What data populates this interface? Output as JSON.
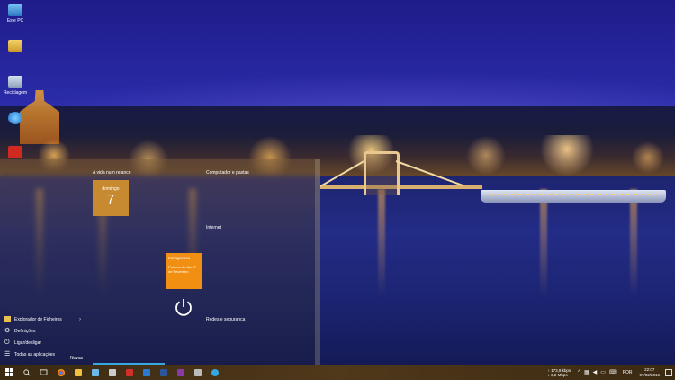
{
  "desktop": {
    "icons": [
      {
        "label": "Este PC",
        "icon": "computer-icon"
      },
      {
        "label": "",
        "icon": "user-folder-icon"
      },
      {
        "label": "Reciclagem",
        "icon": "recycle-bin-icon"
      },
      {
        "label": "",
        "icon": "internet-explorer-icon"
      },
      {
        "label": "",
        "icon": "pdf-icon"
      }
    ]
  },
  "start_menu": {
    "groups": {
      "life": "A vida num relance",
      "computer": "Computador e pastas",
      "internet": "Internet",
      "networks": "Redes e segurança"
    },
    "tiles": {
      "date": {
        "day_name": "domingo",
        "day_number": "7"
      },
      "transfer": {
        "title": "transgenera",
        "body": "Palavra do dia 07 de Fevereiro"
      }
    },
    "left_items": [
      {
        "label": "Explorador de Ficheiros",
        "icon": "folder-icon",
        "has_chevron": true
      },
      {
        "label": "Definições",
        "icon": "gear-icon",
        "has_chevron": false
      },
      {
        "label": "Ligar/desligar",
        "icon": "power-icon",
        "has_chevron": false
      },
      {
        "label": "Todas as aplicações",
        "icon": "apps-icon",
        "has_chevron": false
      }
    ],
    "new_label": "Novas"
  },
  "taskbar": {
    "apps": [
      {
        "name": "search-icon",
        "color": "#ffffff"
      },
      {
        "name": "task-view-icon",
        "color": "#ffffff"
      },
      {
        "name": "chrome-icon",
        "color": "#4caf50"
      },
      {
        "name": "file-explorer-icon",
        "color": "#f0c040"
      },
      {
        "name": "store-icon",
        "color": "#6bb8e8"
      },
      {
        "name": "calculator-icon",
        "color": "#cccccc"
      },
      {
        "name": "acrobat-icon",
        "color": "#d0302a"
      },
      {
        "name": "media-icon",
        "color": "#2a7ad0"
      },
      {
        "name": "word-icon",
        "color": "#2b579a"
      },
      {
        "name": "onenote-icon",
        "color": "#8a3aa8"
      },
      {
        "name": "calculator2-icon",
        "color": "#bbbbbb"
      },
      {
        "name": "telegram-icon",
        "color": "#34a8e0"
      }
    ],
    "network": {
      "up": "173,9 kbps",
      "down": "3,2 Mbps"
    },
    "language": "POR",
    "time": "22:07",
    "date": "07/02/2016"
  }
}
